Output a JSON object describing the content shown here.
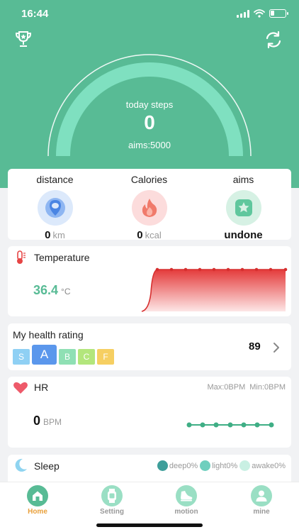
{
  "status_bar": {
    "time": "16:44"
  },
  "header": {
    "steps_label": "today steps",
    "steps_value": "0",
    "aims_text": "aims:5000",
    "step_progress": 0
  },
  "summary": {
    "distance": {
      "title": "distance",
      "value": "0",
      "unit": "km"
    },
    "calories": {
      "title": "Calories",
      "value": "0",
      "unit": "kcal"
    },
    "aims": {
      "title": "aims",
      "value": "undone"
    }
  },
  "temperature": {
    "title": "Temperature",
    "value": "36.4",
    "unit": "°C"
  },
  "health": {
    "title": "My health rating",
    "grades": [
      "S",
      "A",
      "B",
      "C",
      "F"
    ],
    "active_grade": "A",
    "score": "89"
  },
  "hr": {
    "title": "HR",
    "max": "Max:0BPM",
    "min": "Min:0BPM",
    "value": "0",
    "unit": "BPM"
  },
  "sleep": {
    "title": "Sleep",
    "legend": [
      {
        "label": "deep0%",
        "color": "#3e9e9a"
      },
      {
        "label": "light0%",
        "color": "#6fcfbe"
      },
      {
        "label": "awake0%",
        "color": "#c9f0e3"
      }
    ]
  },
  "tabs": [
    {
      "label": "Home",
      "icon": "home-icon"
    },
    {
      "label": "Setting",
      "icon": "watch-icon"
    },
    {
      "label": "motion",
      "icon": "shoe-icon"
    },
    {
      "label": "mine",
      "icon": "user-icon"
    }
  ],
  "colors": {
    "brand_green": "#58bb95",
    "tab_active": "#e9a03b",
    "temperature_red": "#e64545"
  }
}
